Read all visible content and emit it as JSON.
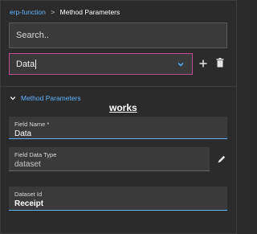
{
  "breadcrumb": {
    "parent": "erp-function",
    "separator": ">",
    "current": "Method Parameters"
  },
  "search": {
    "placeholder": "Search..",
    "value": ""
  },
  "selector": {
    "value": "Data",
    "chevron_icon": "chevron-down-icon",
    "border_color": "#c04a8f"
  },
  "actions": {
    "add_icon": "plus-icon",
    "delete_icon": "trash-icon"
  },
  "section": {
    "title": "Method Parameters",
    "expanded": true,
    "annotation": "works"
  },
  "fields": [
    {
      "label": "Field Name *",
      "value": "Data"
    },
    {
      "label": "Field Data Type",
      "value": "dataset",
      "edit_icon": "pencil-icon"
    },
    {
      "label": "Dataset Id",
      "value": "Receipt"
    }
  ],
  "colors": {
    "accent": "#5fb3ff",
    "background": "#2b2b2b",
    "field_background": "#3a3a3a"
  }
}
